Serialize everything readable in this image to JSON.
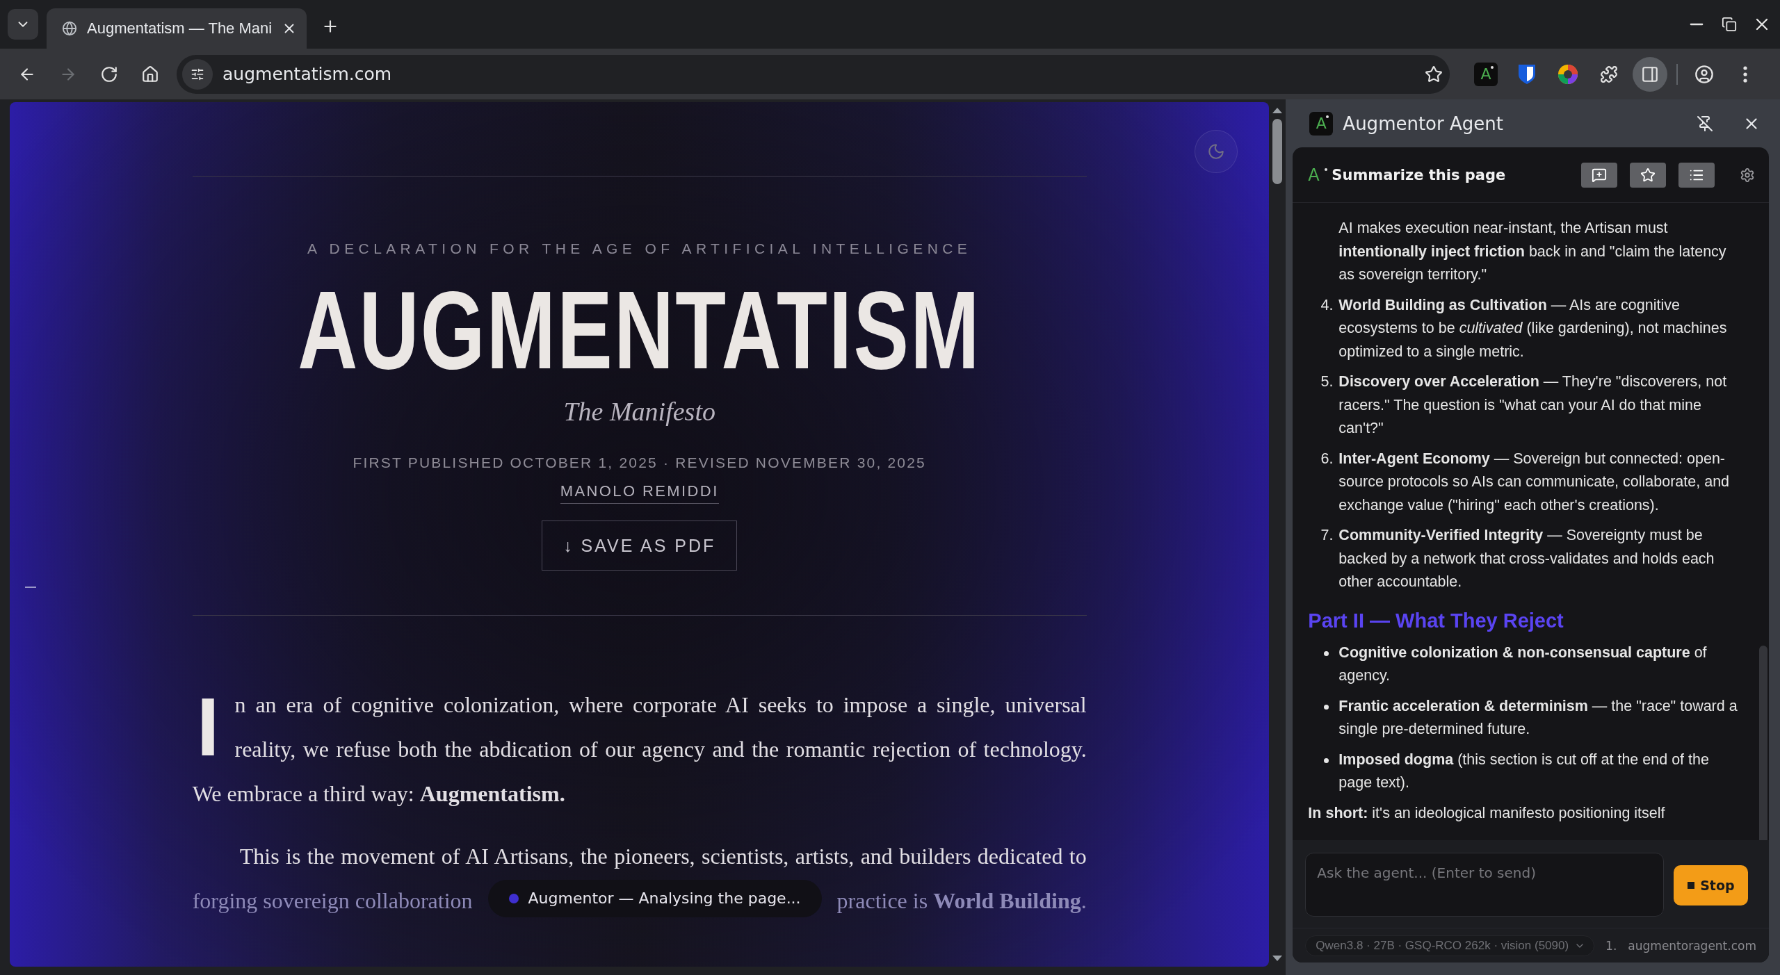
{
  "browser": {
    "tabs": [
      {
        "title": "Augmentatism — The Mani",
        "selected": true
      }
    ],
    "nav_buttons": [
      {
        "kind": "back",
        "disabled": false
      },
      {
        "kind": "forward",
        "disabled": true
      },
      {
        "kind": "reload",
        "disabled": false
      },
      {
        "kind": "home",
        "disabled": false
      }
    ],
    "address_bar": {
      "url": "augmentatism.com"
    },
    "extension_logo": "A",
    "side_panel_button": {
      "active": true
    }
  },
  "page": {
    "kicker": "A DECLARATION FOR THE AGE OF ARTIFICIAL INTELLIGENCE",
    "title": "AUGMENTATISM",
    "subtitle": "The Manifesto",
    "dates": "FIRST PUBLISHED OCTOBER 1, 2025 · REVISED NOVEMBER 30, 2025",
    "author": "MANOLO REMIDDI",
    "save_button": "↓ SAVE AS PDF",
    "intro": {
      "drop_cap": "I",
      "text": "n an era of cognitive colonization, where corporate AI seeks to impose a single, universal reality, we refuse both the abdication of our agency and the romantic rejection of technology. We embrace a third way: **Augmentatism.**"
    },
    "second_paragraph": {
      "first_line": "This is the movement of AI Artisans, the pioneers, scientists, artists, and builders dedicated to",
      "line_start": "forging sovereign collaboration",
      "line_end": "practice is **World Building**."
    },
    "toast": {
      "text": "Augmentor — Analysing the page..."
    }
  },
  "side_panel": {
    "logo": "A",
    "title": "Augmentor Agent",
    "card": {
      "logo": "A",
      "title": "Summarize this page",
      "items": [
        {
          "kind": "continuation",
          "text": "AI makes execution near-instant, the Artisan must **intentionally inject friction** back in and \"claim the latency as sovereign territory.\""
        },
        {
          "kind": "numbered",
          "number": "4.",
          "text": "**World Building as Cultivation** — AIs are cognitive ecosystems to be *cultivated* (like gardening), not machines optimized to a single metric."
        },
        {
          "kind": "numbered",
          "number": "5.",
          "text": "**Discovery over Acceleration** — They're \"discoverers, not racers.\" The question is \"what can your AI do that mine can't?\""
        },
        {
          "kind": "numbered",
          "number": "6.",
          "text": "**Inter-Agent Economy** — Sovereign but connected: open-source protocols so AIs can communicate, collaborate, and exchange value (\"hiring\" each other's creations)."
        },
        {
          "kind": "numbered",
          "number": "7.",
          "text": "**Community-Verified Integrity** — Sovereignty must be backed by a network that cross-validates and holds each other accountable."
        },
        {
          "kind": "heading",
          "text": "**Part II — What They Reject**"
        },
        {
          "kind": "bullet",
          "text": "**Cognitive colonization & non-consensual capture** of agency."
        },
        {
          "kind": "bullet",
          "text": "**Frantic acceleration & determinism** — the \"race\" toward a single pre-determined future."
        },
        {
          "kind": "bullet",
          "text": "**Imposed dogma** (this section is cut off at the end of the page text)."
        },
        {
          "kind": "paragraph",
          "text": "**In short:** it's an ideological manifesto positioning itself"
        }
      ]
    },
    "composer": {
      "placeholder": "Ask the agent... (Enter to send)",
      "stop_button": "Stop"
    },
    "footer": {
      "model": "Qwen3.8 · 27B · GSQ-RCO 262k · vision (5090)",
      "count": "1.",
      "domain": "augmentoragent.com"
    }
  }
}
